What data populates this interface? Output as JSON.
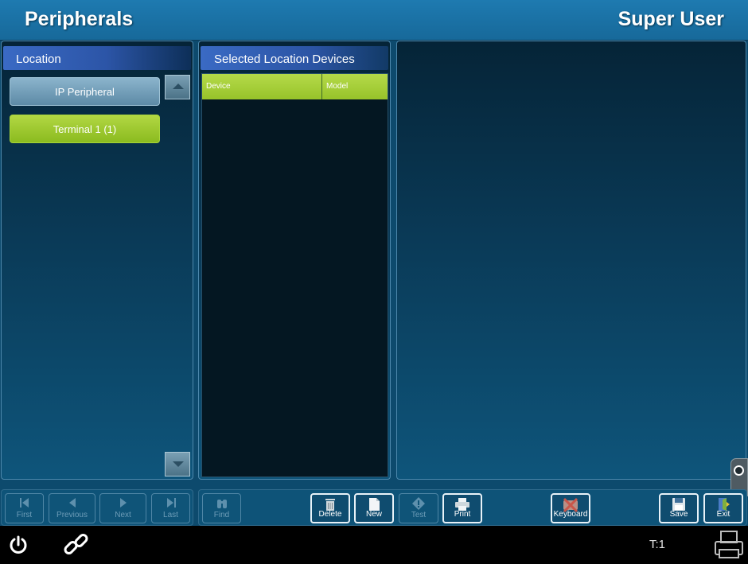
{
  "header": {
    "title": "Peripherals",
    "user": "Super User"
  },
  "location_panel": {
    "header": "Location",
    "items": [
      {
        "label": "IP Peripheral",
        "state": "normal"
      },
      {
        "label": "Terminal 1 (1)",
        "state": "selected"
      }
    ]
  },
  "devices_panel": {
    "header": "Selected Location Devices",
    "columns": [
      "Device",
      "Model"
    ],
    "rows": []
  },
  "nav_toolbar": {
    "first": "First",
    "previous": "Previous",
    "next": "Next",
    "last": "Last"
  },
  "action_toolbar": {
    "find": "Find",
    "delete": "Delete",
    "new": "New",
    "test": "Test",
    "print": "Print",
    "keyboard": "Keyboard",
    "save": "Save",
    "exit": "Exit"
  },
  "status_bar": {
    "terminal": "T:1"
  },
  "colors": {
    "title_bar": "#1e7ab0",
    "selected_item": "#a3cc33",
    "panel_header": "#3a6ac4"
  }
}
